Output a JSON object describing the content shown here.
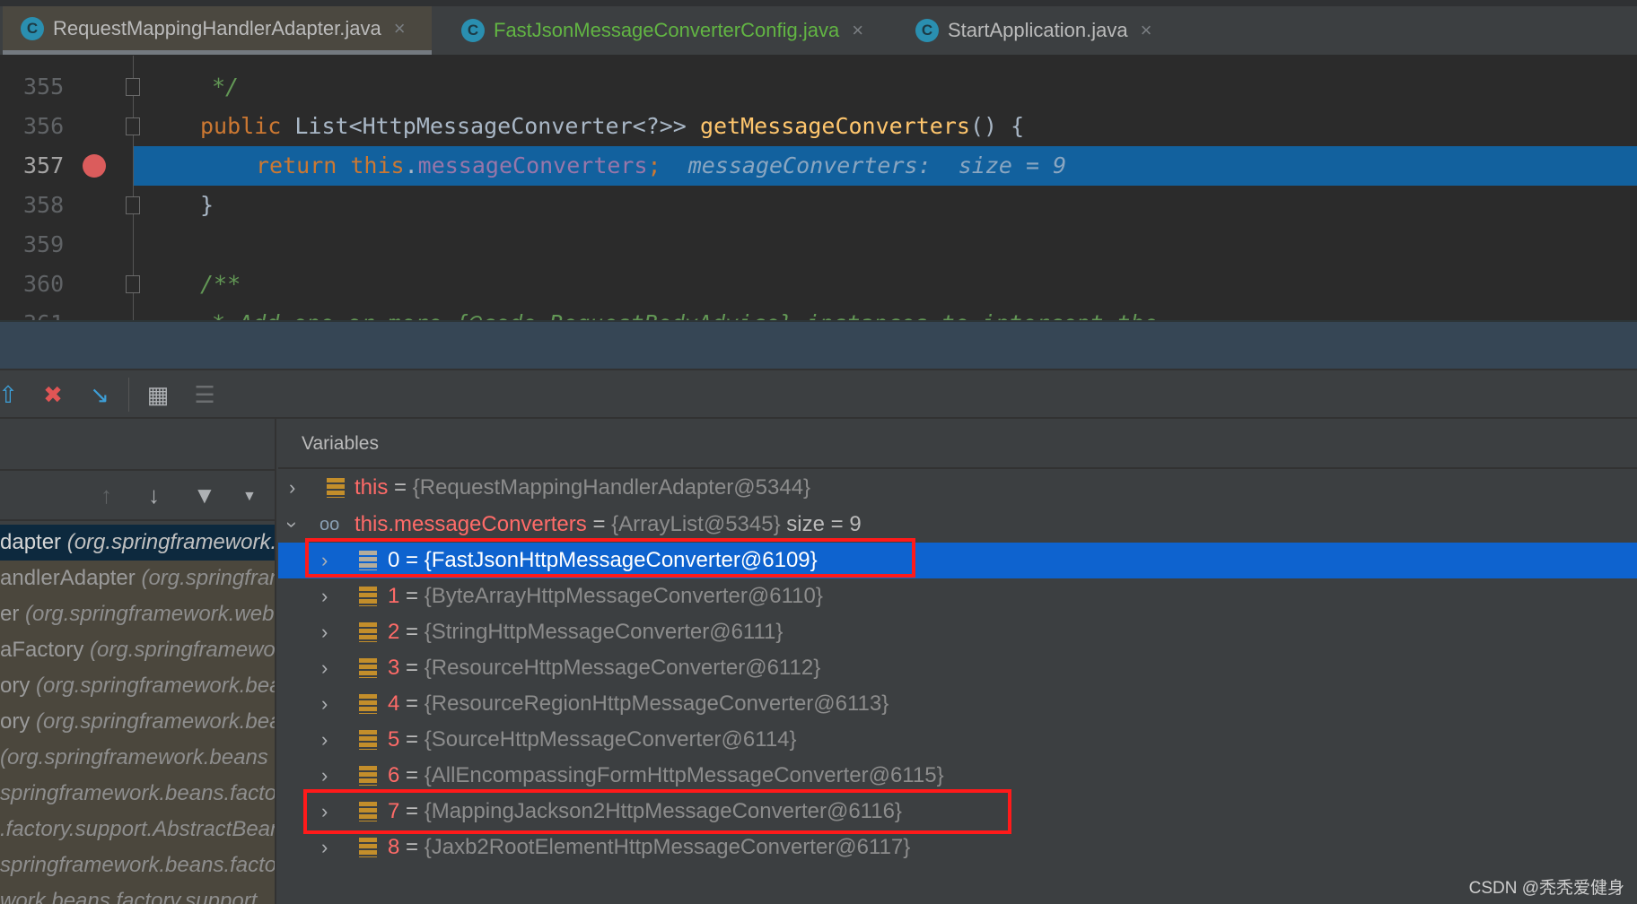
{
  "tabs": [
    {
      "label": "RequestMappingHandlerAdapter.java",
      "active": true,
      "color": "#bbbbbb",
      "icon": "class-locked-icon"
    },
    {
      "label": "FastJsonMessageConverterConfig.java",
      "active": false,
      "color": "#62b543",
      "icon": "class-icon"
    },
    {
      "label": "StartApplication.java",
      "active": false,
      "color": "#bbbbbb",
      "icon": "run-class-icon"
    }
  ],
  "tab_close": "×",
  "editor": {
    "lines": [
      {
        "num": "355",
        "text": "*/"
      },
      {
        "num": "356",
        "kw": "public",
        "type": "List<HttpMessageConverter<?>>",
        "fn": "getMessageConverters",
        "rest": "() {"
      },
      {
        "num": "357",
        "kw": "return",
        "this": "this",
        "dot": ".",
        "field": "messageConverters",
        "semi": ";",
        "hint": "messageConverters:  size = 9"
      },
      {
        "num": "358",
        "text": "}"
      },
      {
        "num": "359",
        "text": ""
      },
      {
        "num": "360",
        "text": "/**"
      },
      {
        "num": "361",
        "text": "* Add one or more {@code RequestBodyAdvice} instances to intercept the"
      }
    ],
    "current_line_color": "#12619e"
  },
  "variables_panel": {
    "title": "Variables",
    "rows": [
      {
        "name": "this",
        "eq": "=",
        "value": "{RequestMappingHandlerAdapter@5344}",
        "expanded": false,
        "icon": "field-icon"
      },
      {
        "name": "this.messageConverters",
        "eq": "=",
        "value": "{ArrayList@5345}",
        "extra": "size = 9",
        "expanded": true,
        "icon": "watch-icon"
      }
    ],
    "children": [
      {
        "index": "0",
        "value": "{FastJsonHttpMessageConverter@6109}",
        "selected": true,
        "highlighted": true
      },
      {
        "index": "1",
        "value": "{ByteArrayHttpMessageConverter@6110}"
      },
      {
        "index": "2",
        "value": "{StringHttpMessageConverter@6111}"
      },
      {
        "index": "3",
        "value": "{ResourceHttpMessageConverter@6112}"
      },
      {
        "index": "4",
        "value": "{ResourceRegionHttpMessageConverter@6113}"
      },
      {
        "index": "5",
        "value": "{SourceHttpMessageConverter@6114}"
      },
      {
        "index": "6",
        "value": "{AllEncompassingFormHttpMessageConverter@6115}"
      },
      {
        "index": "7",
        "value": "{MappingJackson2HttpMessageConverter@6116}",
        "highlighted": true
      },
      {
        "index": "8",
        "value": "{Jaxb2RootElementHttpMessageConverter@6117}"
      }
    ]
  },
  "frames": [
    {
      "name": "dapter ",
      "pkg": "(org.springframework.web",
      "selected": true
    },
    {
      "name": "andlerAdapter ",
      "pkg": "(org.springframework"
    },
    {
      "name": "er ",
      "pkg": "(org.springframework.web"
    },
    {
      "name": "aFactory ",
      "pkg": "(org.springframework"
    },
    {
      "name": "ory ",
      "pkg": "(org.springframework.beans"
    },
    {
      "name": "ory ",
      "pkg": "(org.springframework.beans"
    },
    {
      "name": "",
      "pkg": "(org.springframework.beans"
    },
    {
      "name": "",
      "pkg": "springframework.beans.factory"
    },
    {
      "name": "",
      "pkg": ".factory.support.AbstractBean"
    },
    {
      "name": "",
      "pkg": "springframework.beans.factory"
    },
    {
      "name": "",
      "pkg": "work.beans.factory.support"
    }
  ],
  "watermark": "CSDN @秃秃爱健身",
  "colors": {
    "highlight_box": "#ff1a1a",
    "selected_row": "#0e63cf",
    "var_name": "#ff6b68"
  }
}
